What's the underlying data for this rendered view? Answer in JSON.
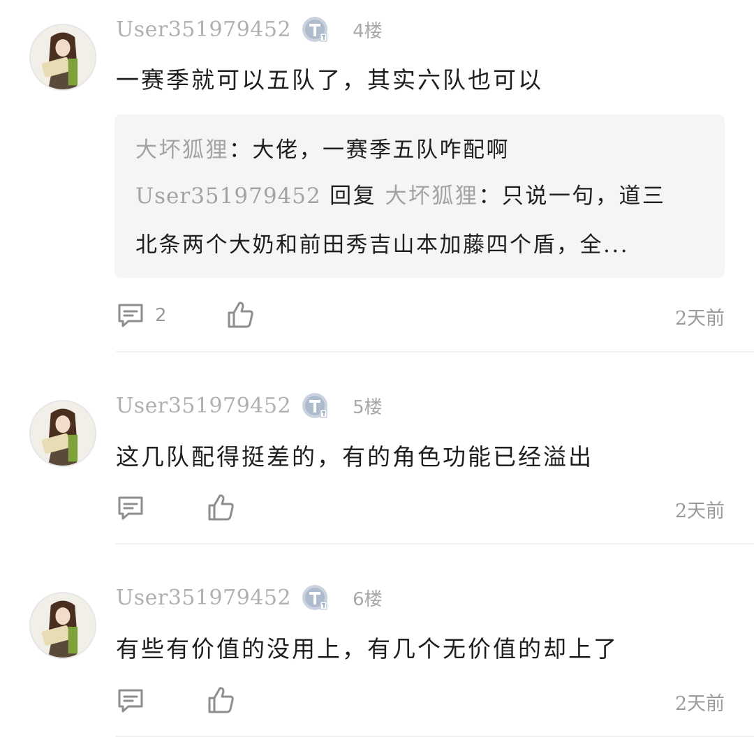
{
  "posts": [
    {
      "username": "User351979452",
      "floor": "4楼",
      "content": "一赛季就可以五队了，其实六队也可以",
      "reply": {
        "line1_name": "大坏狐狸",
        "line1_text": "：大佬，一赛季五队咋配啊",
        "line2_user": "User351979452",
        "line2_mid": " 回复 ",
        "line2_name": "大坏狐狸",
        "line2_text": "：只说一句，道三",
        "line3_text": "北条两个大奶和前田秀吉山本加藤四个盾，全..."
      },
      "comment_count": "2",
      "time": "2天前"
    },
    {
      "username": "User351979452",
      "floor": "5楼",
      "content": "这几队配得挺差的，有的角色功能已经溢出",
      "time": "2天前"
    },
    {
      "username": "User351979452",
      "floor": "6楼",
      "content": "有些有价值的没用上，有几个无价值的却上了",
      "time": "2天前"
    }
  ],
  "colors": {
    "username": "#b0b0b0",
    "reply_bg": "#f5f5f5",
    "text": "#1e1e1e",
    "meta": "#9a9a9a"
  }
}
